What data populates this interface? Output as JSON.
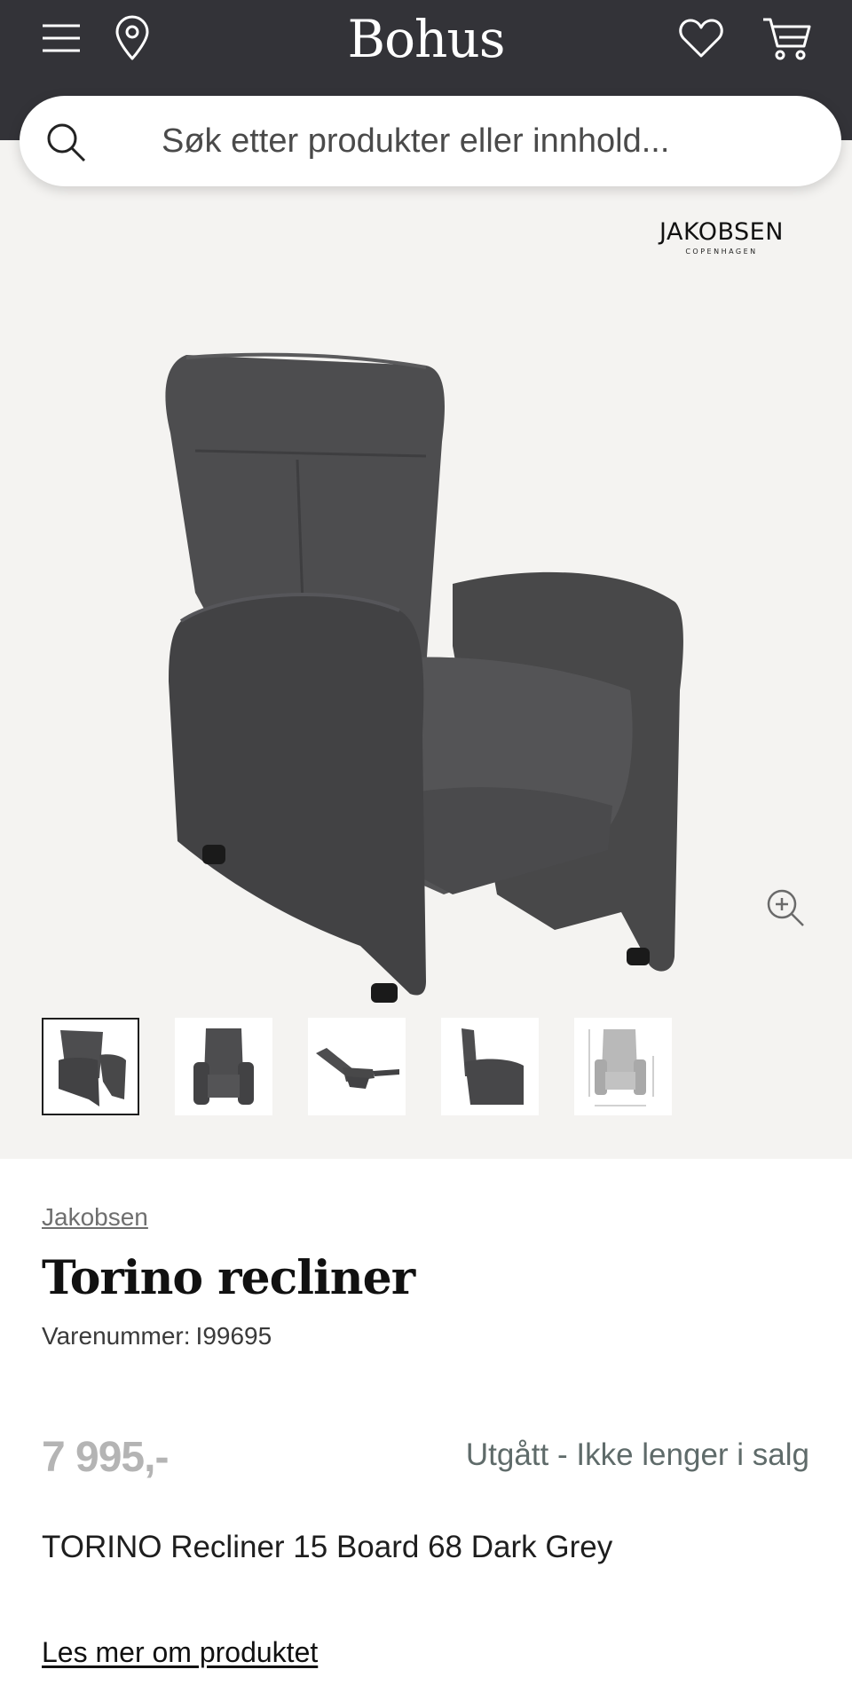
{
  "header": {
    "logo": "Bohus",
    "icons": {
      "menu": "menu-icon",
      "location": "location-pin-icon",
      "favorites": "heart-icon",
      "cart": "cart-icon"
    }
  },
  "search": {
    "placeholder": "Søk etter produkter eller innhold...",
    "value": "",
    "icon": "search-icon"
  },
  "gallery": {
    "brand_logo": "JAKOBSEN",
    "brand_logo_sub": "COPENHAGEN",
    "zoom_icon": "zoom-in-icon",
    "thumbnails": [
      {
        "view": "front-angle",
        "active": true
      },
      {
        "view": "front",
        "active": false
      },
      {
        "view": "side-reclined",
        "active": false
      },
      {
        "view": "side",
        "active": false
      },
      {
        "view": "dimensions",
        "active": false
      }
    ]
  },
  "product": {
    "brand": "Jakobsen",
    "title": "Torino recliner",
    "sku_label": "Varenummer:",
    "sku": "I99695",
    "price": "7 995,-",
    "status": "Utgått - Ikke lenger i salg",
    "description": "TORINO Recliner 15 Board 68 Dark Grey",
    "more_link": "Les mer om produktet"
  },
  "colors": {
    "header_bg": "#333338",
    "gallery_bg": "#f4f3f1",
    "chair": "#4a4a4c",
    "price_muted": "#b4b4b4",
    "status_text": "#5f6b6a"
  }
}
